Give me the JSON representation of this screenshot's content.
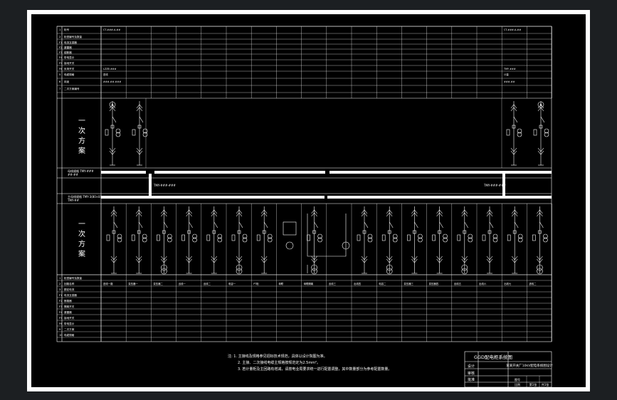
{
  "sheet": {
    "background": "#000000",
    "border": "#ffffff",
    "viewport_bg": "#1c1f22"
  },
  "upper_rows": [
    {
      "no": "1",
      "label": "柜号"
    },
    {
      "no": "2",
      "label": "柜型编号及数量"
    },
    {
      "no": "F1",
      "label": "电流互感器"
    },
    {
      "no": "F2",
      "label": "避雷器"
    },
    {
      "no": "F3",
      "label": "熔断器"
    },
    {
      "no": "F4",
      "label": "带电显示"
    },
    {
      "no": "F5",
      "label": "接地开关"
    },
    {
      "no": "F6",
      "label": "负荷开关"
    },
    {
      "no": "5",
      "label": "电缆规格"
    },
    {
      "no": "6",
      "label": "用途"
    },
    {
      "no": "7",
      "label": "二次方案编号"
    }
  ],
  "upper_left_values": [
    "CT-###-A-##",
    "",
    "",
    "",
    "",
    "",
    "",
    "LZZB ###",
    "进线",
    "###-##-###"
  ],
  "upper_right_values": [
    "CT-###-A-##",
    "",
    "",
    "",
    "",
    "",
    "",
    "TMY ###",
    "计量",
    "###-##"
  ],
  "upper_section_label": "一次方案",
  "lower_section_label": "一次方案",
  "upper_bus_label": "母线规格 TMY-###",
  "upper_bus_label2": "##-##",
  "lower_bus_label": "主母线规格 TMY-3(80×8)",
  "lower_bus_label2": "TMY-##",
  "tie_label_left": "TMY-###-###",
  "tie_label_right": "TMY-###-###",
  "lower_rows": [
    {
      "no": "1",
      "label": "柜型编号及数量"
    },
    {
      "no": "2",
      "label": "回路名称"
    },
    {
      "no": "3",
      "label": "额定电流"
    },
    {
      "no": "F1",
      "label": "电流互感器"
    },
    {
      "no": "F2",
      "label": "断路器"
    },
    {
      "no": "F3",
      "label": "隔离开关"
    },
    {
      "no": "F4",
      "label": "避雷器"
    },
    {
      "no": "F5",
      "label": "接地开关"
    },
    {
      "no": "F6",
      "label": "带电显示"
    },
    {
      "no": "9",
      "label": "二次方案"
    },
    {
      "no": "10",
      "label": "电缆规格"
    }
  ],
  "lower_circuits": [
    "进线一路",
    "变压器一",
    "变压器二",
    "出线一",
    "出线二",
    "电容一",
    "PT柜",
    "母联",
    "母联隔离",
    "出线三",
    "出线四",
    "电容二",
    "变压器三",
    "变压器四",
    "出线五",
    "出线六",
    "出线七",
    "进线二"
  ],
  "notes": [
    "注: 1. 主接线及规格参见招标技术规范，具体以设计院图为准。",
    "2. 主接、二次接线电缆主规格按规范定为2.5mm²。",
    "3. 若计量柜及主回路有增减，请按电业局要求统一进行配置调整，其中数量部分为参考配置数量。"
  ],
  "title_block": {
    "title": "GGD配电柜系统图",
    "project": "某某开关厂10kV配电系统图设计",
    "row_labels": [
      "设计",
      "审核",
      "批准"
    ],
    "sheet_name": "图号",
    "scale": "比例",
    "page": "第1张",
    "total": "共1张"
  }
}
